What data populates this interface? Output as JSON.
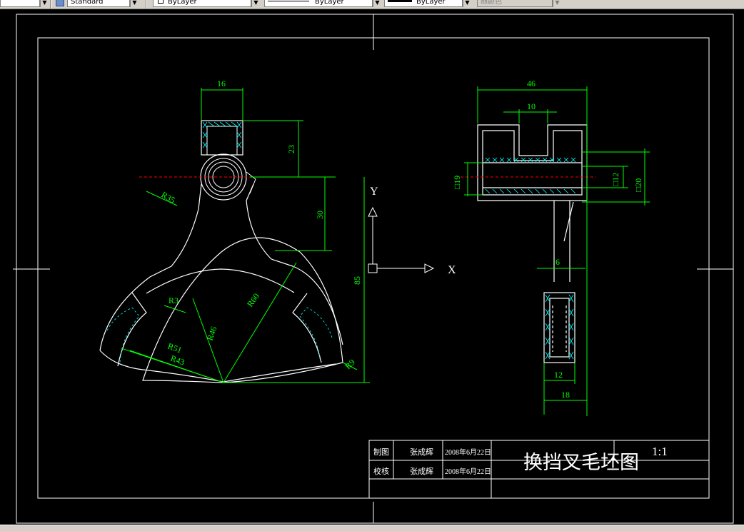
{
  "toolbar": {
    "textstyle_value": "Standard",
    "layer_value": "ByLayer",
    "linetype_value": "ByLayer",
    "lineweight_value": "ByLayer",
    "plotstyle_value": "随颜色"
  },
  "drawing": {
    "dimensions": {
      "d16": "16",
      "d23": "23",
      "d30": "30",
      "d85": "85",
      "r35": "R35",
      "r3": "R3",
      "r60": "R60",
      "r46": "R46",
      "r51": "R51",
      "r43": "R43",
      "r9": "R9",
      "d46": "46",
      "d10": "10",
      "d19": "□19",
      "d12v": "□12",
      "d20": "□20",
      "d6": "6",
      "d12": "12",
      "d18": "18"
    },
    "ucs": {
      "x_label": "X",
      "y_label": "Y"
    },
    "title_block": {
      "row1_role": "制图",
      "row1_name": "张成辉",
      "row1_date": "2008年6月22日",
      "row2_role": "校核",
      "row2_name": "张成辉",
      "row2_date": "2008年6月22日",
      "title": "换挡叉毛坯图",
      "scale": "1:1"
    }
  },
  "colors": {
    "background": "#000000",
    "geometry": "#ffffff",
    "dimension": "#00ff00",
    "hatch": "#00ffff",
    "centerline": "#ff0000"
  }
}
